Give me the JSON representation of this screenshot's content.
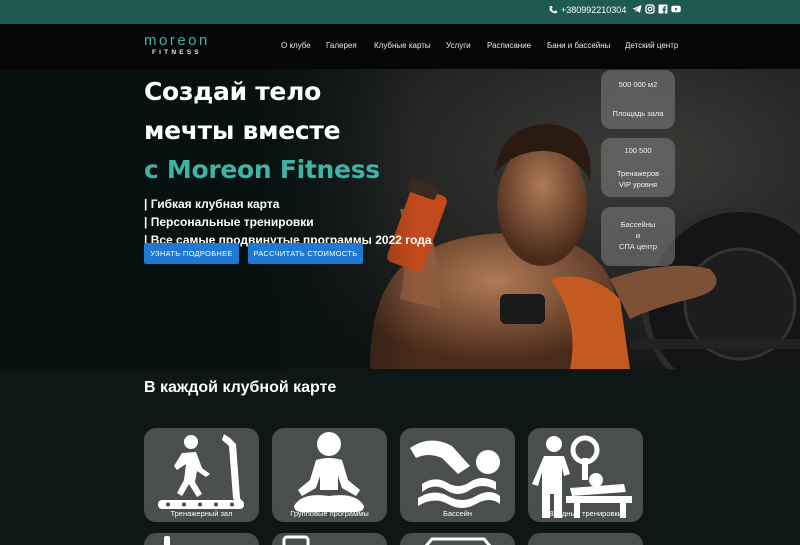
{
  "topbar": {
    "phone": "+380992210304",
    "icons": [
      "phone-icon",
      "telegram-icon",
      "instagram-icon",
      "facebook-icon",
      "youtube-icon"
    ]
  },
  "logo": {
    "line1": "moreon",
    "line2": "FITNESS"
  },
  "nav": {
    "items": [
      "О клубе",
      "Галерея",
      "Клубные карты",
      "Услуги",
      "Расписание",
      "Бани и бассейны",
      "Детский центр"
    ]
  },
  "hero": {
    "title_line1": "Создай тело",
    "title_line2": "мечты вместе",
    "title_line3": "с Moreon Fitness",
    "bullets": [
      "| Гибкая клубная карта",
      "| Персональные тренировки",
      "| Все самые продвинутые программы 2022 года"
    ],
    "button_more": "УЗНАТЬ ПОДРОБНЕЕ",
    "button_cost": "РАССЧИТАТЬ СТОИМОСТЬ",
    "stats": [
      {
        "value": "500 000 м2",
        "label": "Площадь зала"
      },
      {
        "value": "100 500",
        "label1": "Тренажеров",
        "label2": "VIP уровня"
      },
      {
        "value": "Бассейны",
        "label1": "и",
        "label2": "СПА центр"
      }
    ]
  },
  "section": {
    "title": "В каждой клубной карте",
    "cards": [
      "Тренажерный зал",
      "Групповые программы",
      "Бассейн",
      "Вводные тренировки"
    ]
  },
  "colors": {
    "accent": "#3fb3a6",
    "topbar": "#1f5a52",
    "button": "#1f78d1",
    "card": "#4a4e4d"
  }
}
